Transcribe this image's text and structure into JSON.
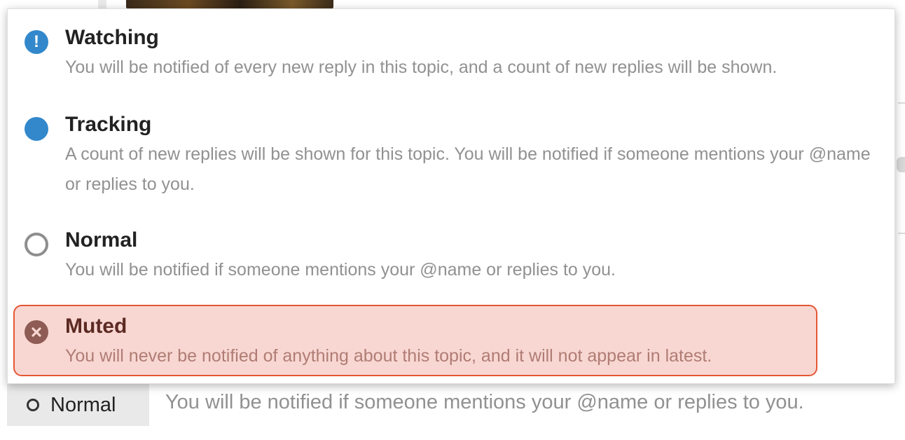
{
  "menu": {
    "options": [
      {
        "title": "Watching",
        "description": "You will be notified of every new reply in this topic, and a count of new replies will be shown.",
        "icon": "exclamation-circle-icon",
        "icon_glyph": "!",
        "color": "#3288cb"
      },
      {
        "title": "Tracking",
        "description": "A count of new replies will be shown for this topic. You will be notified if someone mentions your @name or replies to you.",
        "icon": "filled-circle-icon",
        "color": "#3288cb"
      },
      {
        "title": "Normal",
        "description": "You will be notified if someone mentions your @name or replies to you.",
        "icon": "empty-circle-icon",
        "color": "#8e8e8e"
      },
      {
        "title": "Muted",
        "description": "You will never be notified of anything about this topic, and it will not appear in latest.",
        "icon": "times-circle-icon",
        "color": "#8f5c55",
        "highlighted": true,
        "highlight_color": "#f8d7d2",
        "border_color": "#e45735"
      }
    ]
  },
  "footer": {
    "button_label": "Normal",
    "button_icon": "empty-circle-icon",
    "description": "You will be notified if someone mentions your @name or replies to you."
  }
}
